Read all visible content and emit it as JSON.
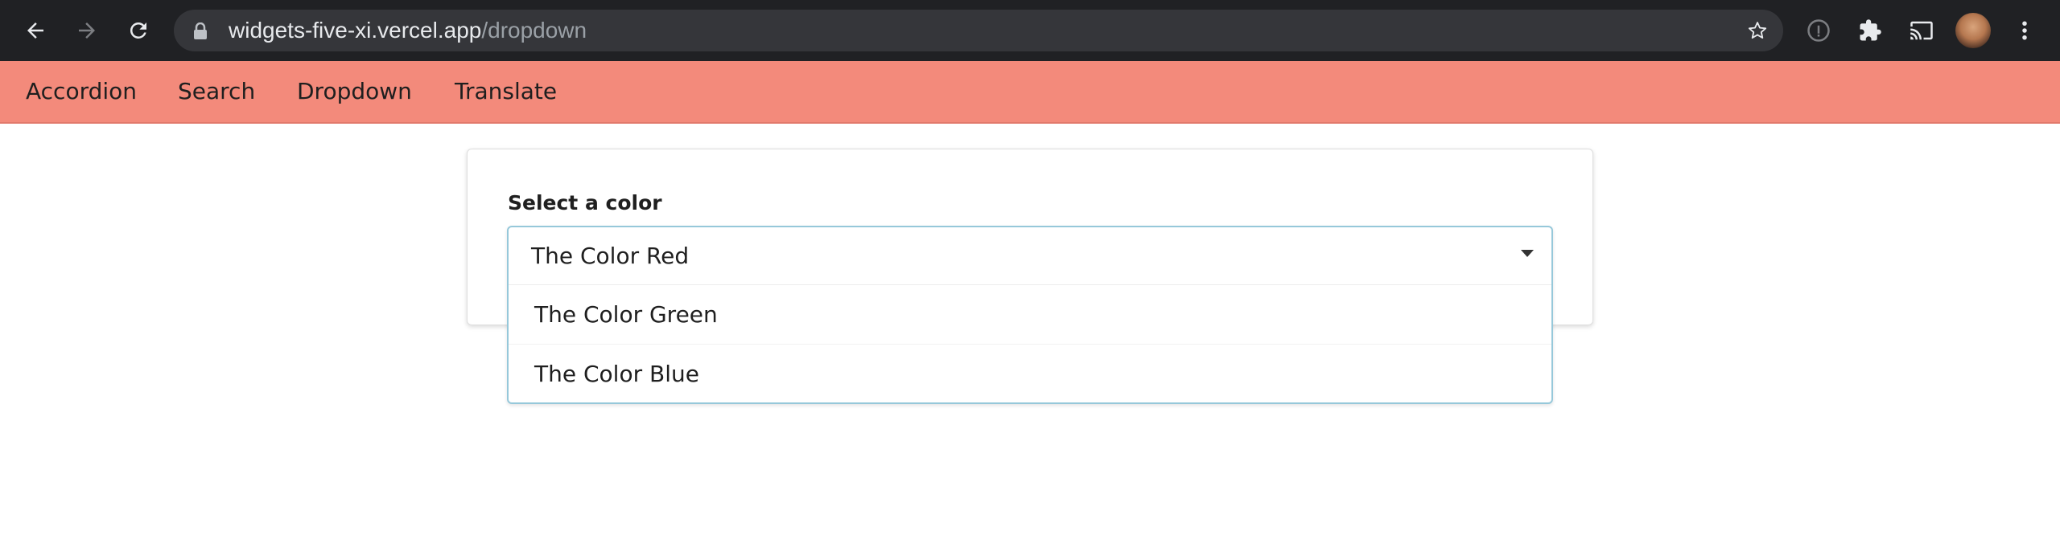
{
  "browser": {
    "url_host": "widgets-five-xi.vercel.app",
    "url_path": "/dropdown",
    "icons": [
      "back-icon",
      "forward-icon",
      "reload-icon",
      "lock-icon",
      "star-icon",
      "info-icon",
      "extensions-icon",
      "cast-icon",
      "avatar",
      "menu-icon"
    ]
  },
  "nav": {
    "items": [
      {
        "label": "Accordion"
      },
      {
        "label": "Search"
      },
      {
        "label": "Dropdown"
      },
      {
        "label": "Translate"
      }
    ],
    "color": "#f38a7b"
  },
  "form": {
    "label": "Select a color",
    "selected": "The Color Red",
    "options": [
      {
        "label": "The Color Green"
      },
      {
        "label": "The Color Blue"
      }
    ],
    "border_color": "#96c8da"
  }
}
